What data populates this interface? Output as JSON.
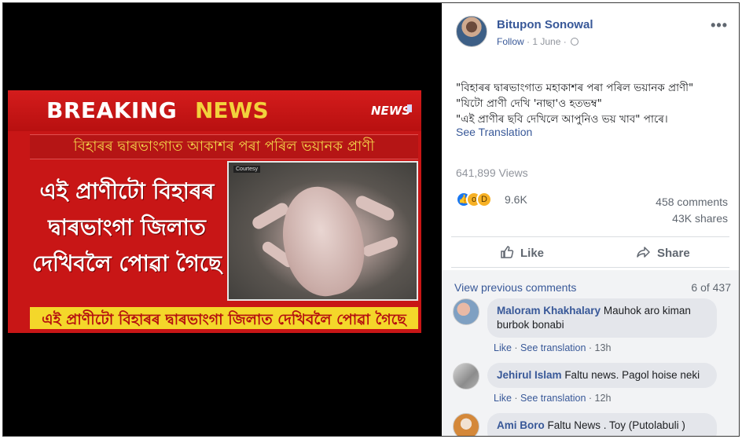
{
  "video": {
    "headline_breaking": "BREAKING",
    "headline_news": "NEWS",
    "channel_logo": "NEWS",
    "sub_banner": "বিহাৰৰ দ্বাৰভাংগাত আকাশৰ পৰা পৰিল ভয়ানক প্ৰাণী",
    "body_lines": [
      "এই প্ৰাণীটো বিহাৰৰ",
      "দ্বাৰভাংগা জিলাত",
      "দেখিবলৈ পোৱা গৈছে"
    ],
    "photo_tag": "Courtesy",
    "ticker": "এই প্ৰাণীটো বিহাৰৰ দ্বাৰভাংগা জিলাত দেখিবলৈ পোৱা গৈছে"
  },
  "post": {
    "author": "Bitupon Sonowal",
    "follow_label": "Follow",
    "date": "1 June",
    "text_lines": [
      "\"বিহাৰৰ দ্বাৰভাংগাত মহাকাশৰ পৰা পৰিল ভয়ানক প্ৰাণী\"",
      "\"যিটো প্ৰাণী দেখি 'নাছা'ও হতভম্ব\"",
      "\"এই প্ৰাণীৰ ছবি দেখিলে আপুনিও ভয় খাব\" পাৰে।"
    ],
    "see_translation": "See Translation",
    "views": "641,899 Views",
    "reaction_count": "9.6K",
    "comments_count": "458 comments",
    "shares_count": "43K shares",
    "like_label": "Like",
    "share_label": "Share"
  },
  "comments": {
    "view_previous": "View previous comments",
    "count": "6 of 437",
    "items": [
      {
        "name": "Maloram Khakhalary",
        "text_line1": "Mauhok aro kiman",
        "text_line2": "burbok bonabi",
        "like": "Like",
        "see_translation": "See translation",
        "time": "13h"
      },
      {
        "name": "Jehirul Islam",
        "text_line1": "Faltu news. Pagol hoise neki",
        "like": "Like",
        "see_translation": "See translation",
        "time": "12h"
      },
      {
        "name": "Ami Boro",
        "text_line1": "Faltu News . Toy (Putolabuli )"
      }
    ]
  },
  "colors": {
    "fb_blue": "#385898",
    "breaking_red": "#c81616",
    "news_yellow": "#f2d23c"
  }
}
